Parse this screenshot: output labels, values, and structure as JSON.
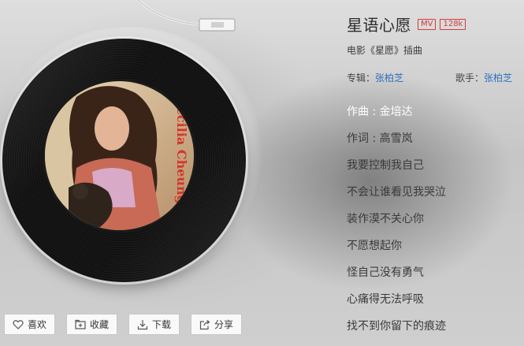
{
  "song": {
    "title": "星语心愿",
    "badge_mv": "MV",
    "badge_quality": "128k",
    "subtitle": "电影《星愿》插曲",
    "album_label": "专辑：",
    "album": "张柏芝",
    "singer_label": "歌手：",
    "singer": "张柏芝"
  },
  "lyrics": [
    "作曲 : 金培达",
    "作词 : 高雪岚",
    "我要控制我自己",
    "不会让谁看见我哭泣",
    "装作漠不关心你",
    "不愿想起你",
    "怪自己没有勇气",
    "心痛得无法呼吸",
    "找不到你留下的痕迹"
  ],
  "current_lyric_index": 0,
  "cover": {
    "text": "Cecilia Cheung",
    "icon": "album-cover-image"
  },
  "actions": {
    "like": "喜欢",
    "collect": "收藏",
    "download": "下载",
    "share": "分享"
  },
  "colors": {
    "accent_link": "#2f6ec2",
    "badge_red": "#d23c3c"
  }
}
